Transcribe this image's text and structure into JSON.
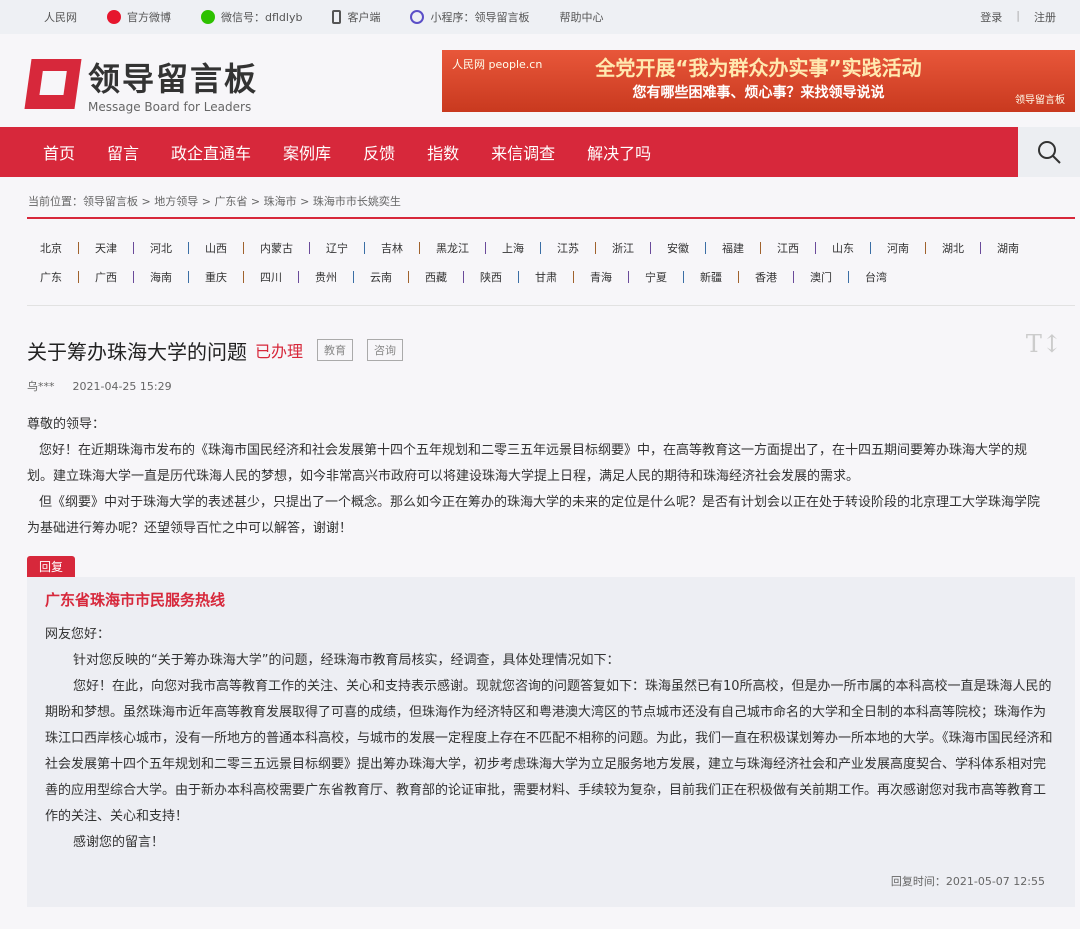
{
  "topbar": {
    "items": [
      "人民网",
      "官方微博",
      "微信号：dfldlyb",
      "客户端",
      "小程序：领导留言板",
      "帮助中心"
    ],
    "login": "登录",
    "divider": "|",
    "register": "注册"
  },
  "logo": {
    "cn": "领导留言板",
    "en": "Message Board for Leaders"
  },
  "banner": {
    "brand": "人民网 people.cn",
    "line1": "全党开展“我为群众办实事”实践活动",
    "line2": "您有哪些困难事、烦心事？来找领导说说",
    "corner": "领导留言板"
  },
  "nav": {
    "items": [
      "首页",
      "留言",
      "政企直通车",
      "案例库",
      "反馈",
      "指数",
      "来信调查",
      "解决了吗"
    ]
  },
  "breadcrumb": {
    "label": "当前位置：",
    "items": [
      "领导留言板",
      "地方领导",
      "广东省",
      "珠海市",
      "珠海市市长姚奕生"
    ],
    "sep": " > "
  },
  "regions": {
    "row1": [
      "北京",
      "天津",
      "河北",
      "山西",
      "内蒙古",
      "辽宁",
      "吉林",
      "黑龙江",
      "上海",
      "江苏",
      "浙江",
      "安徽",
      "福建",
      "江西",
      "山东",
      "河南",
      "湖北",
      "湖南"
    ],
    "row2": [
      "广东",
      "广西",
      "海南",
      "重庆",
      "四川",
      "贵州",
      "云南",
      "西藏",
      "陕西",
      "甘肃",
      "青海",
      "宁夏",
      "新疆",
      "香港",
      "澳门",
      "台湾"
    ]
  },
  "message": {
    "title": "关于筹办珠海大学的问题",
    "status": "已办理",
    "tags": [
      "教育",
      "咨询"
    ],
    "font_toggle": "T↕",
    "author": "乌***",
    "time": "2021-04-25 15:29",
    "greeting": "尊敬的领导：",
    "paragraphs": [
      "您好！在近期珠海市发布的《珠海市国民经济和社会发展第十四个五年规划和二零三五年远景目标纲要》中，在高等教育这一方面提出了，在十四五期间要筹办珠海大学的规划。建立珠海大学一直是历代珠海人民的梦想，如今非常高兴市政府可以将建设珠海大学提上日程，满足人民的期待和珠海经济社会发展的需求。",
      "但《纲要》中对于珠海大学的表述甚少，只提出了一个概念。那么如今正在筹办的珠海大学的未来的定位是什么呢？是否有计划会以正在处于转设阶段的北京理工大学珠海学院为基础进行筹办呢？还望领导百忙之中可以解答，谢谢！"
    ]
  },
  "reply": {
    "label": "回复",
    "org": "广东省珠海市市民服务热线",
    "greeting": "网友您好：",
    "paragraphs": [
      "针对您反映的“关于筹办珠海大学”的问题，经珠海市教育局核实，经调查，具体处理情况如下：",
      "您好！在此，向您对我市高等教育工作的关注、关心和支持表示感谢。现就您咨询的问题答复如下：珠海虽然已有10所高校，但是办一所市属的本科高校一直是珠海人民的期盼和梦想。虽然珠海市近年高等教育发展取得了可喜的成绩，但珠海作为经济特区和粤港澳大湾区的节点城市还没有自己城市命名的大学和全日制的本科高等院校；珠海作为珠江口西岸核心城市，没有一所地方的普通本科高校，与城市的发展一定程度上存在不匹配不相称的问题。为此，我们一直在积极谋划筹办一所本地的大学。《珠海市国民经济和社会发展第十四个五年规划和二零三五远景目标纲要》提出筹办珠海大学，初步考虑珠海大学为立足服务地方发展，建立与珠海经济社会和产业发展高度契合、学科体系相对完善的应用型综合大学。由于新办本科高校需要广东省教育厅、教育部的论证审批，需要材料、手续较为复杂，目前我们正在积极做有关前期工作。再次感谢您对我市高等教育工作的关注、关心和支持！",
      "感谢您的留言！"
    ],
    "time": "回复时间：2021-05-07 12:55"
  }
}
